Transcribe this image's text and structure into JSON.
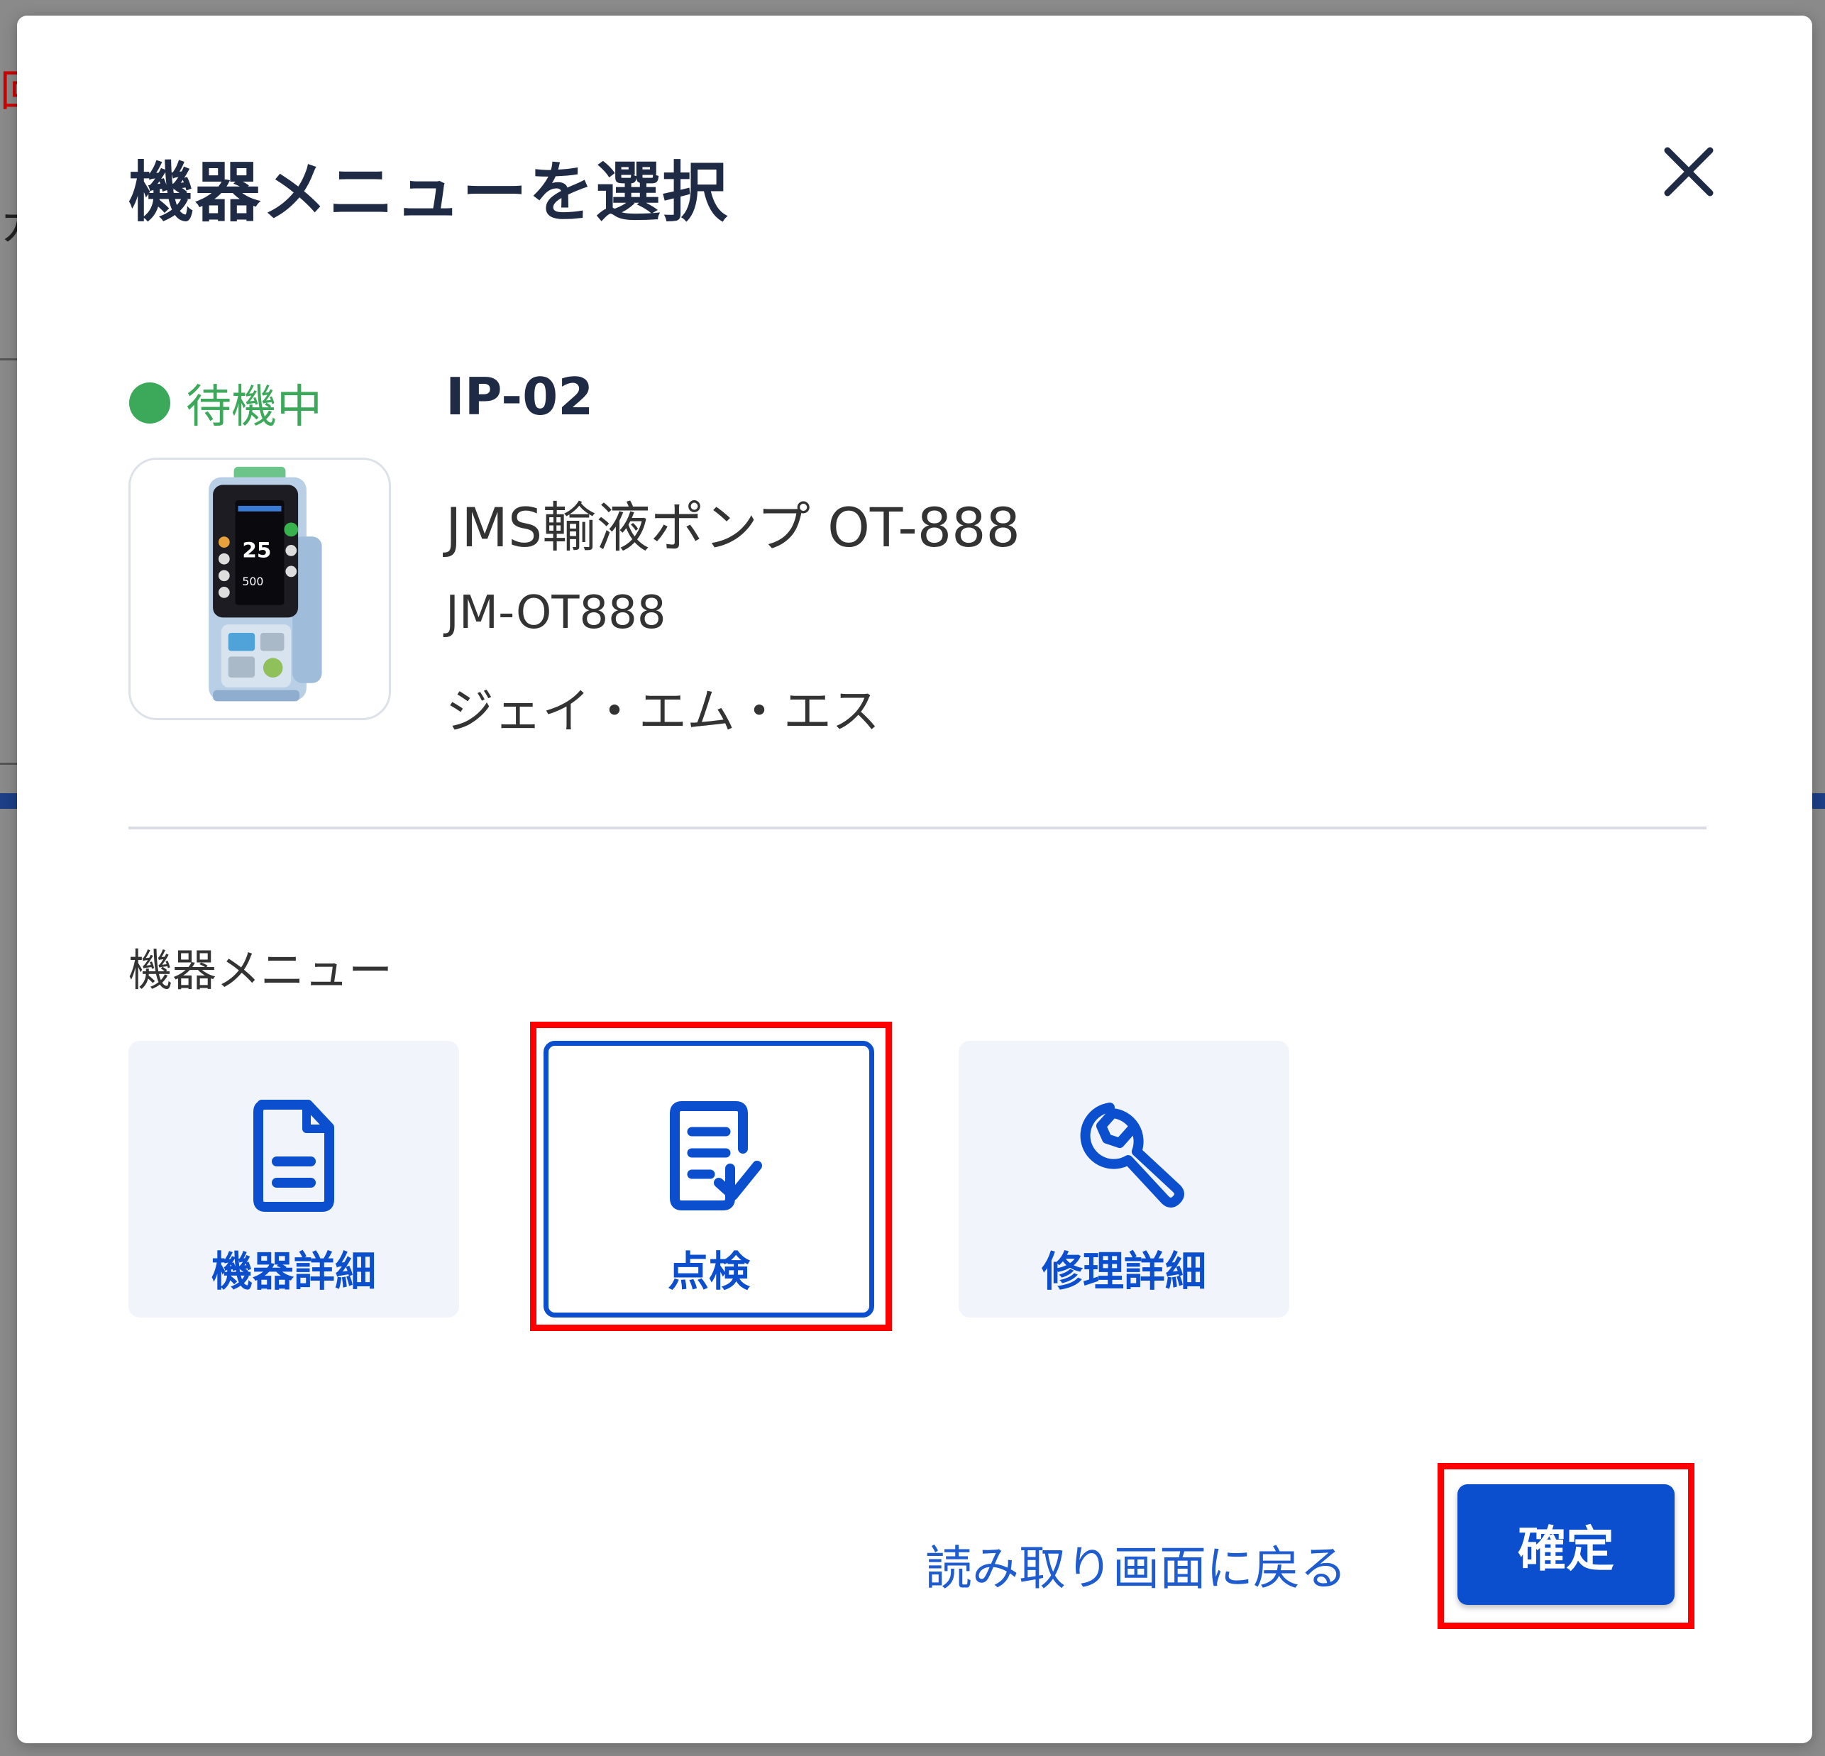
{
  "dialog": {
    "title": "機器メニューを選択",
    "close_icon": "close-icon"
  },
  "device": {
    "status": "待機中",
    "status_color": "#3ca85a",
    "id": "IP-02",
    "name": "JMS輸液ポンプ OT-888",
    "model": "JM-OT888",
    "maker": "ジェイ・エム・エス",
    "screen_value": "25",
    "screen_sub_value": "500"
  },
  "menu": {
    "section_label": "機器メニュー",
    "items": [
      {
        "label": "機器詳細",
        "icon": "document-icon",
        "selected": false
      },
      {
        "label": "点検",
        "icon": "checklist-icon",
        "selected": true
      },
      {
        "label": "修理詳細",
        "icon": "wrench-icon",
        "selected": false
      }
    ]
  },
  "actions": {
    "back_label": "読み取り画面に戻る",
    "confirm_label": "確定"
  },
  "colors": {
    "accent": "#0b4fcf",
    "highlight": "#ff0000",
    "title": "#1f2a44"
  }
}
